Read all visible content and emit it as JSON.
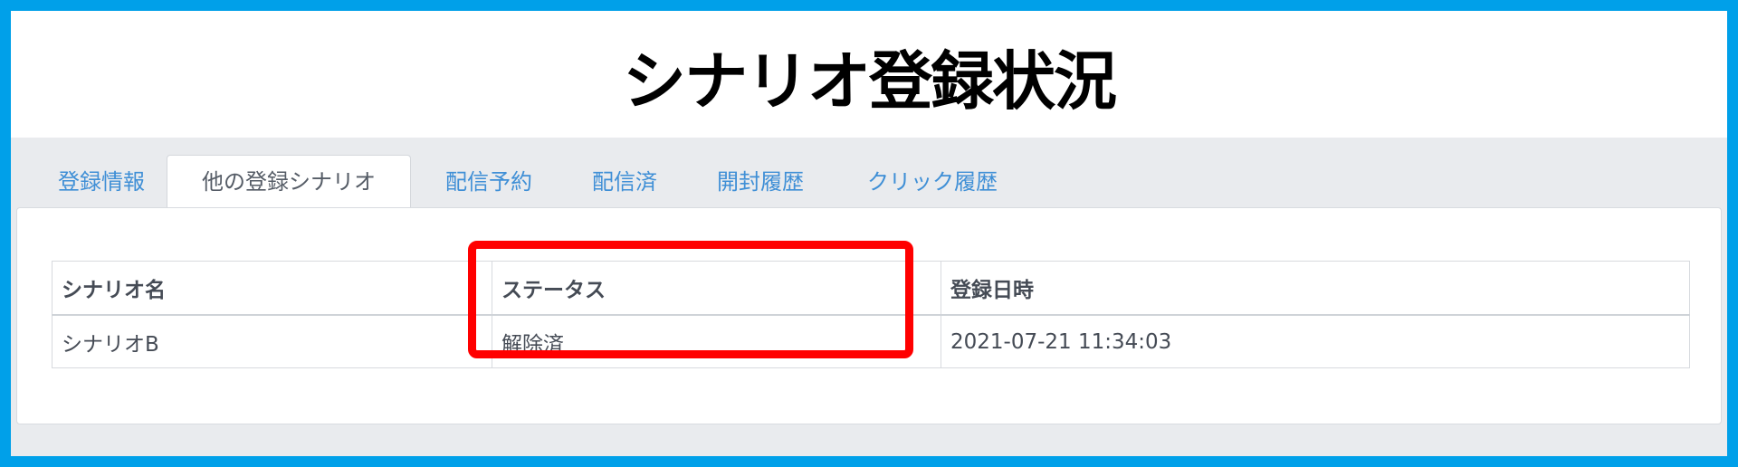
{
  "title": "シナリオ登録状況",
  "tabs": [
    {
      "label": "登録情報",
      "active": false
    },
    {
      "label": "他の登録シナリオ",
      "active": true
    },
    {
      "label": "配信予約",
      "active": false
    },
    {
      "label": "配信済",
      "active": false
    },
    {
      "label": "開封履歴",
      "active": false
    },
    {
      "label": "クリック履歴",
      "active": false
    }
  ],
  "table": {
    "headers": [
      "シナリオ名",
      "ステータス",
      "登録日時"
    ],
    "rows": [
      [
        "シナリオB",
        "解除済",
        "2021-07-21 11:34:03"
      ]
    ]
  },
  "colors": {
    "frame": "#00a0e9",
    "tab_link": "#3f8fd6",
    "highlight": "#ff0000"
  }
}
